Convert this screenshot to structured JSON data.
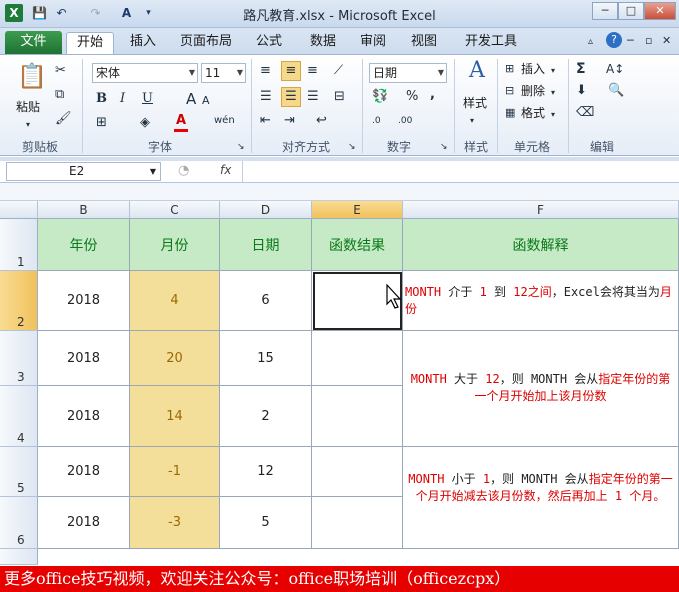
{
  "window": {
    "title": "路凡教育.xlsx - Microsoft Excel",
    "buttons": {
      "minimize": "─",
      "restore": "□",
      "close": "✕"
    }
  },
  "qat": {
    "save": "💾",
    "undo": "↶",
    "redo": "↷",
    "format": "A",
    "more": "▾"
  },
  "tabs": [
    "文件",
    "开始",
    "插入",
    "页面布局",
    "公式",
    "数据",
    "审阅",
    "视图",
    "开发工具"
  ],
  "ribbon": {
    "clipboard": {
      "label": "剪贴板",
      "paste": "粘贴"
    },
    "font": {
      "label": "字体",
      "name": "宋体",
      "size": "11",
      "bold": "B",
      "italic": "I",
      "underline": "U",
      "grow": "A",
      "shrink": "A",
      "wen": "wén"
    },
    "alignment": {
      "label": "对齐方式"
    },
    "number": {
      "label": "数字",
      "format": "日期",
      "percent": "%",
      "comma": ",",
      "dec_inc": ".0",
      "dec_dec": ".00"
    },
    "styles": {
      "label": "样式",
      "button": "样式"
    },
    "cells": {
      "label": "单元格",
      "insert": "插入",
      "delete": "删除",
      "format": "格式"
    },
    "editing": {
      "label": "编辑",
      "sum": "Σ"
    }
  },
  "formula_bar": {
    "name_box": "E2",
    "fx": "fx",
    "content": ""
  },
  "sheet": {
    "columns": [
      "B",
      "C",
      "D",
      "E",
      "F"
    ],
    "selected_column": "E",
    "rows": [
      "1",
      "2",
      "3",
      "4",
      "5",
      "6"
    ],
    "selected_row": "2",
    "headers": [
      "年份",
      "月份",
      "日期",
      "函数结果",
      "函数解释"
    ],
    "data": [
      {
        "year": "2018",
        "month": "4",
        "day": "6"
      },
      {
        "year": "2018",
        "month": "20",
        "day": "15"
      },
      {
        "year": "2018",
        "month": "14",
        "day": "2"
      },
      {
        "year": "2018",
        "month": "-1",
        "day": "12"
      },
      {
        "year": "2018",
        "month": "-3",
        "day": "5"
      }
    ],
    "explanations": {
      "e1": {
        "p1": "MONTH",
        "p2": " 介于 ",
        "p3": "1",
        "p4": " 到 ",
        "p5": "12之间",
        "p6": "，Excel会将其当为",
        "p7": "月份"
      },
      "e2": {
        "p1": "MONTH",
        "p2": " 大于 ",
        "p3": "12",
        "p4": "，则 MONTH 会从",
        "p5": "指定年份的第一个月开始加上该月份数"
      },
      "e3": {
        "p1": "MONTH",
        "p2": " 小于 ",
        "p3": "1",
        "p4": "，则 MONTH 会从",
        "p5": "指定年份的第一个月开始减去该月份数，然后再加上 1 个月。"
      }
    }
  },
  "banner": "更多office技巧视频，欢迎关注公众号：office职场培训（officezcpx）",
  "colors": {
    "header_green": "#c6e9c6",
    "month_yellow": "#f3df9a",
    "banner_red": "#e60000",
    "excel_green": "#1f7233"
  }
}
